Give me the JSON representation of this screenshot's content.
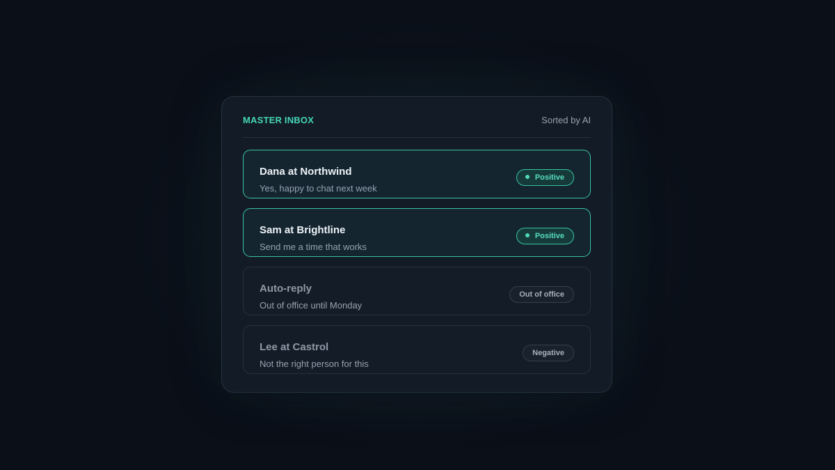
{
  "inbox": {
    "title": "MASTER INBOX",
    "sort_label": "Sorted by AI"
  },
  "threads": [
    {
      "sender": "Dana at Northwind",
      "preview": "Yes, happy to chat next week",
      "badge": "Positive",
      "status": "positive"
    },
    {
      "sender": "Sam at Brightline",
      "preview": "Send me a time that works",
      "badge": "Positive",
      "status": "positive"
    },
    {
      "sender": "Auto-reply",
      "preview": "Out of office until Monday",
      "badge": "Out of office",
      "status": "neutral"
    },
    {
      "sender": "Lee at Castrol",
      "preview": "Not the right person for this",
      "badge": "Negative",
      "status": "negative"
    }
  ],
  "colors": {
    "accent": "#45d6b7",
    "background": "#0a0f18",
    "panel": "#131b26",
    "positive_border": "#3bc4a5"
  }
}
